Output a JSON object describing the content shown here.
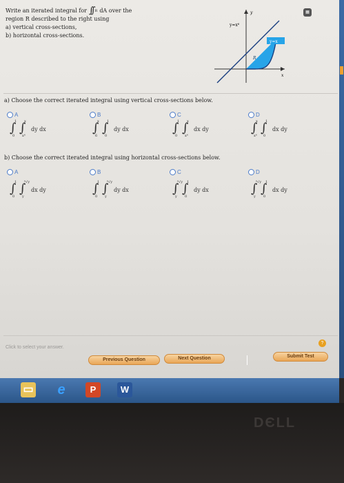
{
  "question": {
    "line1_pre": "Write an iterated integral for",
    "integral_sub": "R",
    "line1_post": "dA over the",
    "line2": "region R described to the right using",
    "line3": "a) vertical cross-sections,",
    "line4": "b) horizontal cross-sections."
  },
  "graph": {
    "y_axis_label": "y",
    "x_axis_label": "x",
    "curve1_label": "y=x⁶",
    "curve2_label": "y=x",
    "region_label": "R",
    "fill_color": "#27a4e8"
  },
  "part_a": {
    "title": "a) Choose the correct iterated integral using vertical cross-sections below.",
    "options": [
      {
        "label": "A",
        "upper1": "1",
        "lower1": "0",
        "upper2": "x",
        "lower2": "x⁶",
        "diff": "dy dx"
      },
      {
        "label": "B",
        "upper1": "x",
        "lower1": "6",
        "upper2": "1",
        "lower2": "0",
        "diff": "dy dx"
      },
      {
        "label": "C",
        "upper1": "1",
        "lower1": "0",
        "upper2": "x",
        "lower2": "x⁶",
        "diff": "dx dy"
      },
      {
        "label": "D",
        "upper1": "x",
        "lower1": "x⁶",
        "upper2": "1",
        "lower2": "0",
        "diff": "dx dy"
      }
    ]
  },
  "part_b": {
    "title": "b) Choose the correct iterated integral using horizontal cross-sections below.",
    "options": [
      {
        "label": "A",
        "upper1": "1",
        "lower1": "0",
        "upper2": "⁶√y",
        "lower2": "y",
        "diff": "dx dy"
      },
      {
        "label": "B",
        "upper1": "1",
        "lower1": "0",
        "upper2": "⁶√y",
        "lower2": "y",
        "diff": "dy dx"
      },
      {
        "label": "C",
        "upper1": "⁶√y",
        "lower1": "y",
        "upper2": "1",
        "lower2": "0",
        "diff": "dy dx"
      },
      {
        "label": "D",
        "upper1": "⁶√y",
        "lower1": "y",
        "upper2": "1",
        "lower2": "0",
        "diff": "dx dy"
      }
    ]
  },
  "footer": {
    "prompt": "Click to select your answer.",
    "help": "?",
    "prev_button": "Previous Question",
    "next_button": "Next Question",
    "submit_button": "Submit Test"
  },
  "taskbar": {
    "icons": [
      "folder-icon",
      "internet-explorer-icon",
      "powerpoint-icon",
      "word-icon"
    ],
    "ppt_letter": "P",
    "word_letter": "W",
    "ie_letter": "e"
  },
  "bezel": {
    "logo": "DЄLL"
  },
  "calculator_icon": "calculator-icon"
}
